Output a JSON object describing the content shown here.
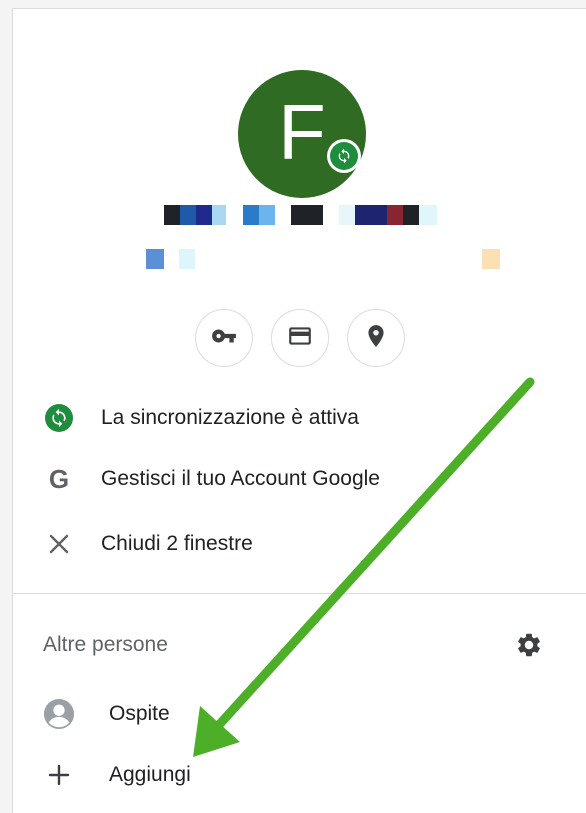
{
  "profile": {
    "initial": "F",
    "colors": {
      "avatar": "#2f6b22",
      "sync_green": "#1e8e3e"
    }
  },
  "quick_actions": [
    {
      "icon": "key-icon"
    },
    {
      "icon": "credit-card-icon"
    },
    {
      "icon": "location-pin-icon"
    }
  ],
  "menu": {
    "sync_label": "La sincronizzazione è attiva",
    "manage_account_label": "Gestisci il tuo Account Google",
    "close_windows_label": "Chiudi 2 finestre"
  },
  "others": {
    "title": "Altre persone",
    "guest_label": "Ospite",
    "add_label": "Aggiungi"
  },
  "annotation": {
    "arrow_color": "#4caf27"
  }
}
